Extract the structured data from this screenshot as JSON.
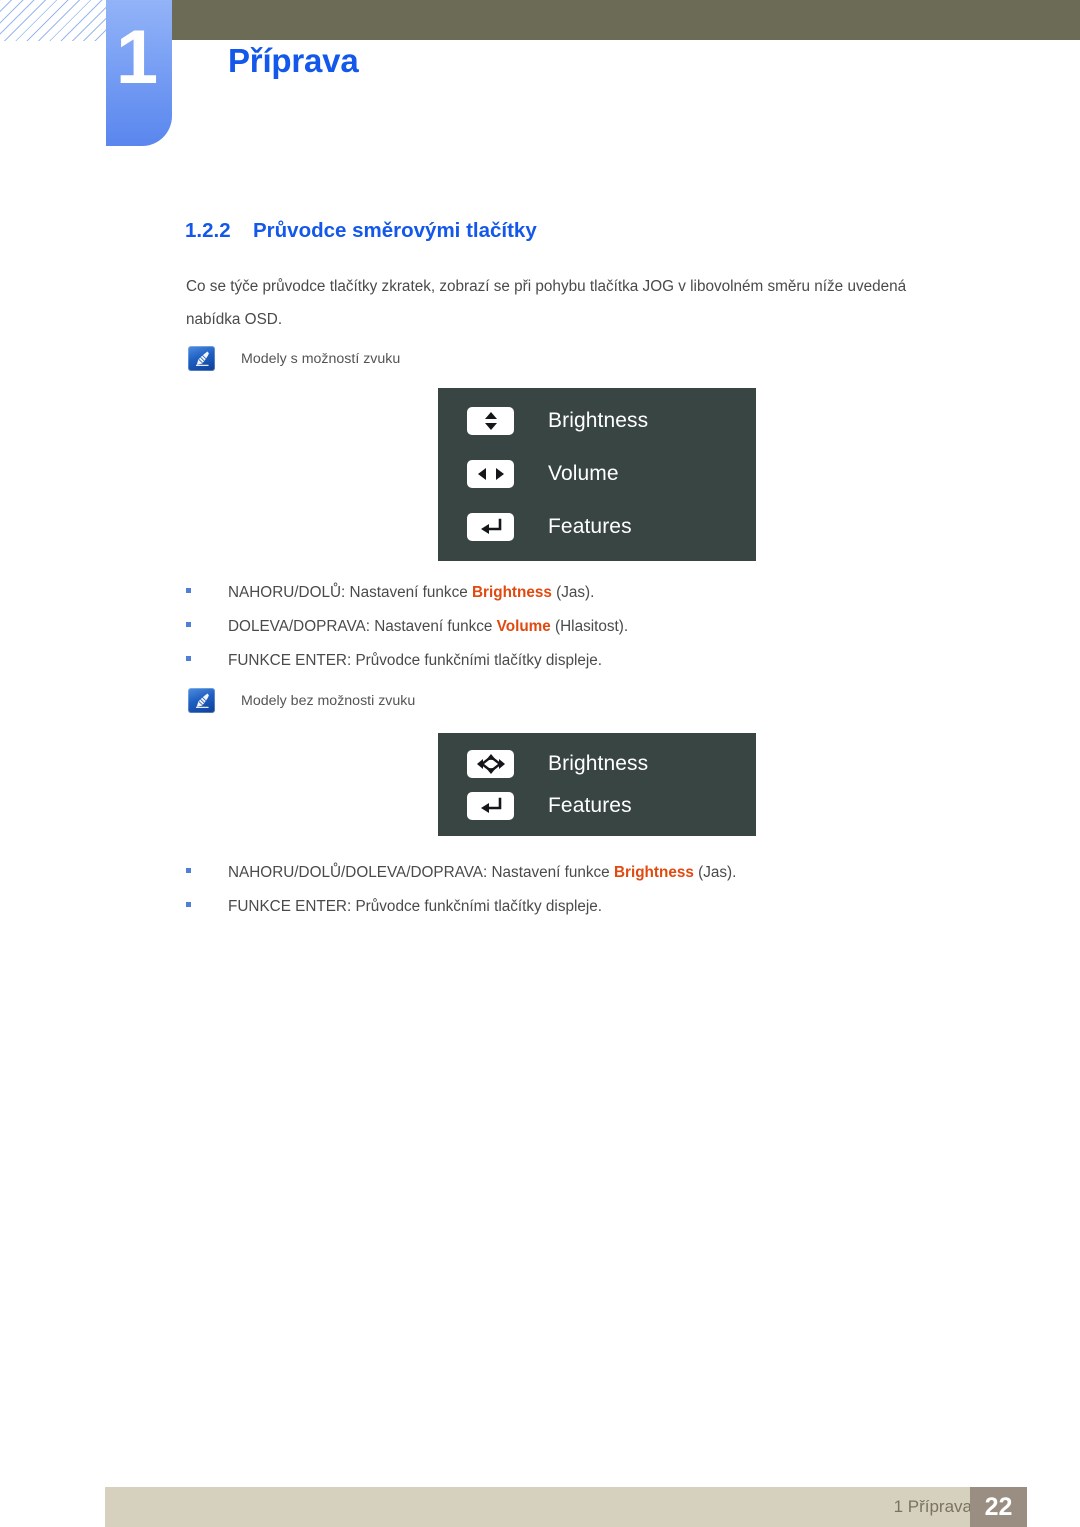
{
  "header": {
    "chapter_number": "1",
    "chapter_title": "Příprava",
    "accent_blue": "#1358ea",
    "olive_bar_color": "#6c6b55",
    "tab_color": "#7ea4f5"
  },
  "section": {
    "number": "1.2.2",
    "title": "Průvodce směrovými tlačítky",
    "paragraph": "Co se týče průvodce tlačítky zkratek, zobrazí se při pohybu tlačítka JOG v libovolném směru níže uvedená nabídka OSD."
  },
  "notes": [
    {
      "icon": "note-pen-icon",
      "label": "Modely s možností zvuku"
    },
    {
      "icon": "note-pen-icon",
      "label": "Modely bez možnosti zvuku"
    }
  ],
  "osd_panels": [
    {
      "name": "osd-panel-with-audio",
      "background": "#394543",
      "rows": [
        {
          "icon": "up-down-arrow-icon",
          "label": "Brightness"
        },
        {
          "icon": "left-right-arrow-icon",
          "label": "Volume"
        },
        {
          "icon": "enter-return-icon",
          "label": "Features"
        }
      ]
    },
    {
      "name": "osd-panel-without-audio",
      "background": "#394543",
      "rows": [
        {
          "icon": "four-way-diamond-icon",
          "label": "Brightness"
        },
        {
          "icon": "enter-return-icon",
          "label": "Features"
        }
      ]
    }
  ],
  "bullet_lists": [
    {
      "name": "bullets-with-audio",
      "items": [
        {
          "pre": "NAHORU/DOLŮ: Nastavení funkce ",
          "highlight": "Brightness",
          "post": " (Jas)."
        },
        {
          "pre": "DOLEVA/DOPRAVA: Nastavení funkce ",
          "highlight": "Volume",
          "post": " (Hlasitost)."
        },
        {
          "pre": "FUNKCE ENTER: Průvodce funkčními tlačítky displeje.",
          "highlight": "",
          "post": ""
        }
      ]
    },
    {
      "name": "bullets-without-audio",
      "items": [
        {
          "pre": "NAHORU/DOLŮ/DOLEVA/DOPRAVA: Nastavení funkce ",
          "highlight": "Brightness",
          "post": " (Jas)."
        },
        {
          "pre": "FUNKCE ENTER: Průvodce funkčními tlačítky displeje.",
          "highlight": "",
          "post": ""
        }
      ]
    }
  ],
  "footer": {
    "label": "1 Příprava",
    "page_number": "22",
    "bar_color": "#d6d1bf",
    "page_box_color": "#9a8d81"
  }
}
